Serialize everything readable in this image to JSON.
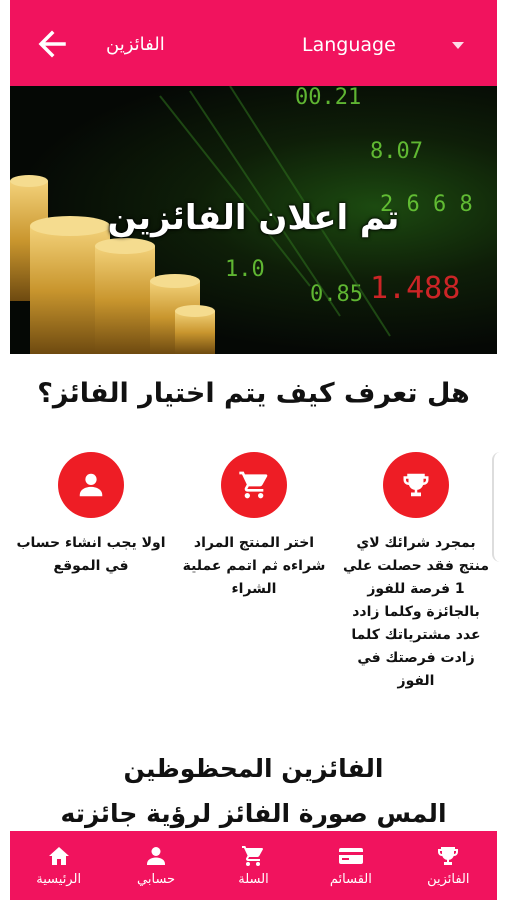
{
  "appbar": {
    "title": "الفائزين",
    "language_label": "Language"
  },
  "hero": {
    "title": "تم اعلان الفائزين"
  },
  "section": {
    "question": "هل تعرف كيف يتم اختيار الفائز؟"
  },
  "steps": [
    {
      "icon": "trophy-icon",
      "text": "بمجرد شرائك لاي منتج فقد حصلت علي 1 فرصة للفوز بالجائزة وكلما زادد عدد مشترياتك كلما زادت فرصتك في الفوز"
    },
    {
      "icon": "cart-icon",
      "text": "اختر المنتج المراد شراءه ثم اتمم عملية الشراء"
    },
    {
      "icon": "person-icon",
      "text": "اولا يجب انشاء حساب في الموقع"
    }
  ],
  "winners": {
    "heading": "الفائزين المحظوظين",
    "subheading": "المس صورة الفائز لرؤية جائزته"
  },
  "bottom_nav": [
    {
      "icon": "trophy-icon",
      "label": "الفائزين"
    },
    {
      "icon": "card-icon",
      "label": "القسائم"
    },
    {
      "icon": "cart-icon",
      "label": "السلة"
    },
    {
      "icon": "person-icon",
      "label": "حسابي"
    },
    {
      "icon": "home-icon",
      "label": "الرئيسية"
    }
  ],
  "colors": {
    "brand": "#f1135e",
    "step_icon_bg": "#ee1d25"
  }
}
